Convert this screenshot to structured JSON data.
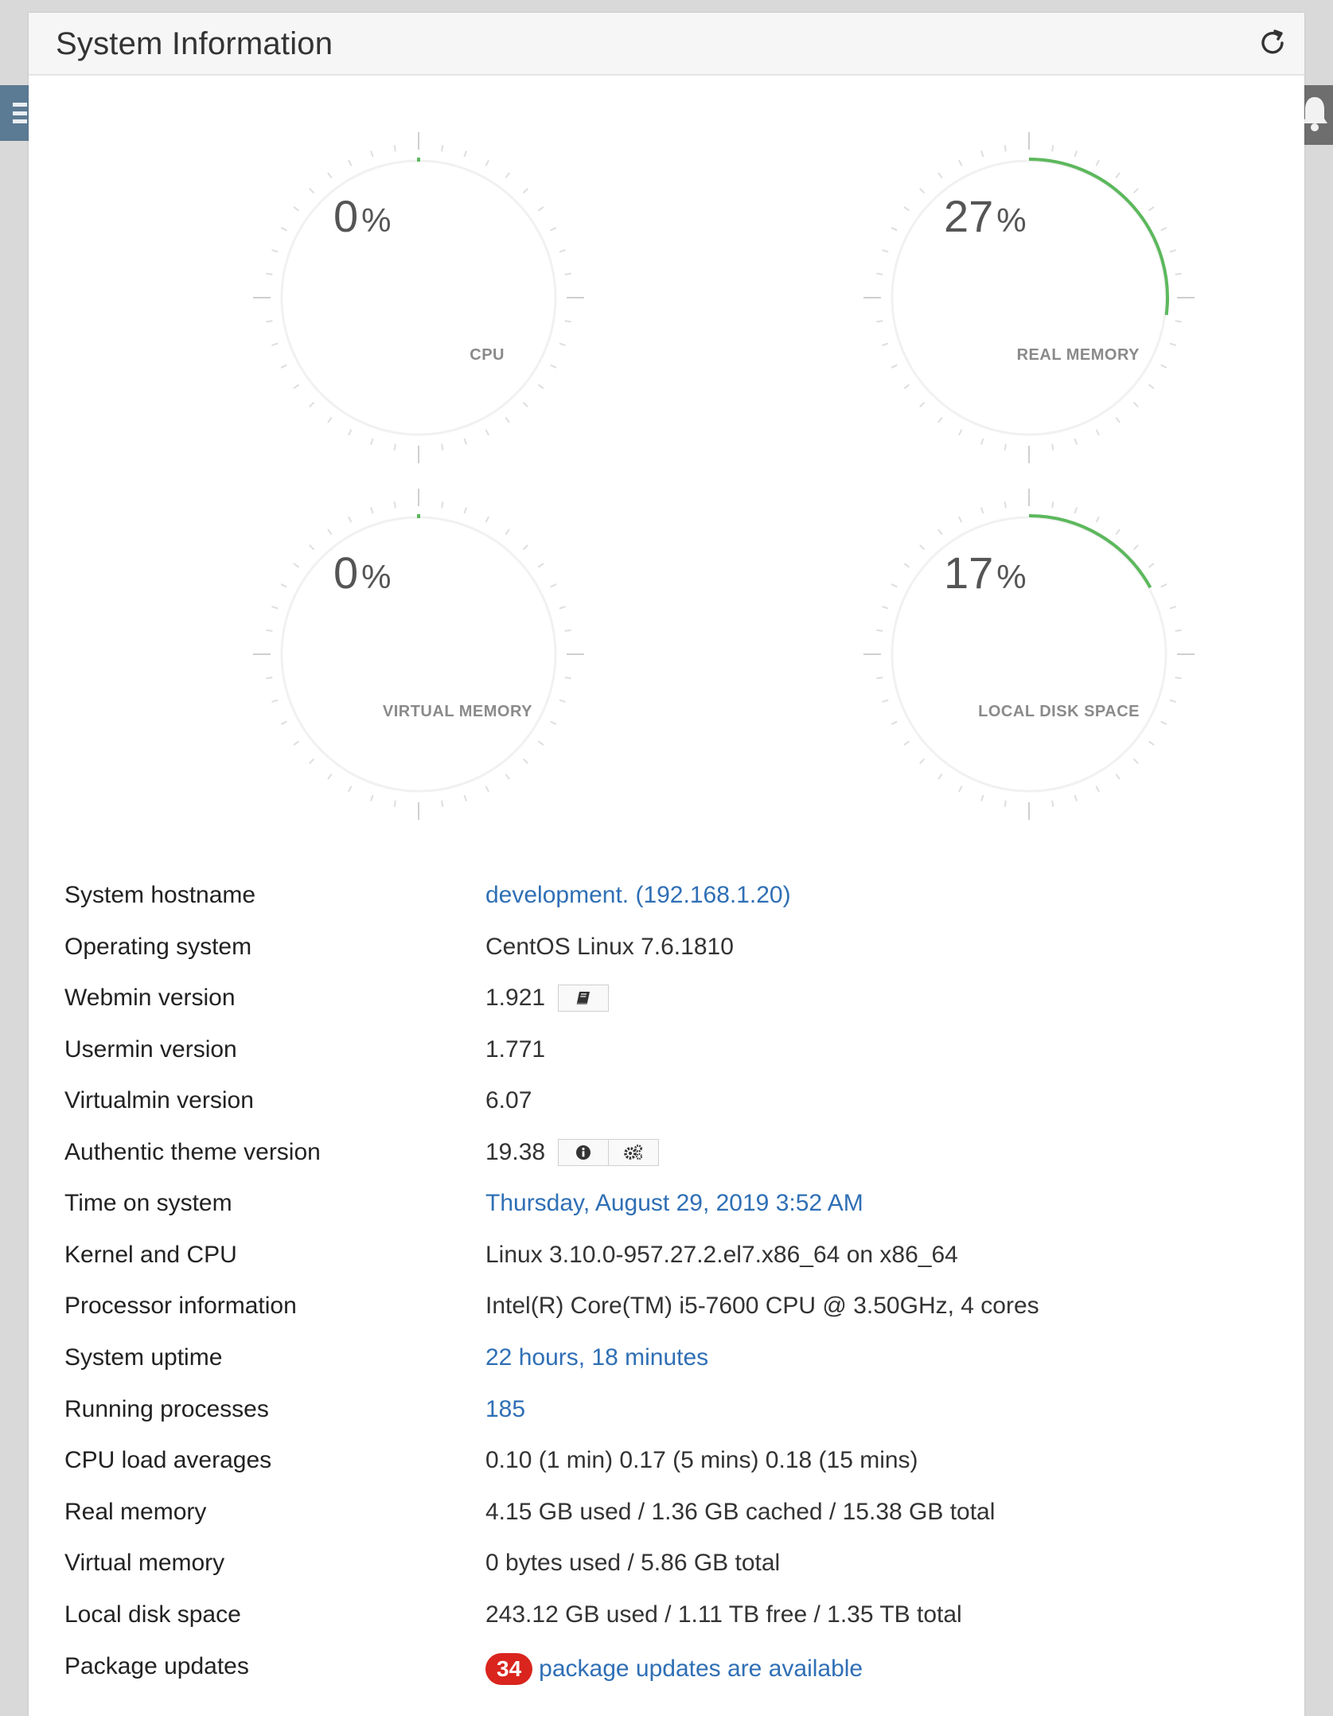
{
  "panel": {
    "title": "System Information"
  },
  "gauges": [
    {
      "value": "0",
      "unit": "%",
      "label": "CPU",
      "percent": 0
    },
    {
      "value": "27",
      "unit": "%",
      "label": "REAL MEMORY",
      "percent": 27
    },
    {
      "value": "0",
      "unit": "%",
      "label": "VIRTUAL MEMORY",
      "percent": 0
    },
    {
      "value": "17",
      "unit": "%",
      "label": "LOCAL DISK SPACE",
      "percent": 17
    }
  ],
  "info": {
    "hostname": {
      "label": "System hostname",
      "value": "development. (192.168.1.20)"
    },
    "os": {
      "label": "Operating system",
      "value": "CentOS Linux 7.6.1810"
    },
    "webmin": {
      "label": "Webmin version",
      "value": "1.921"
    },
    "usermin": {
      "label": "Usermin version",
      "value": "1.771"
    },
    "virtualmin": {
      "label": "Virtualmin version",
      "value": "6.07"
    },
    "theme": {
      "label": "Authentic theme version",
      "value": "19.38"
    },
    "time": {
      "label": "Time on system",
      "value": "Thursday, August 29, 2019 3:52 AM"
    },
    "kernel": {
      "label": "Kernel and CPU",
      "value": "Linux 3.10.0-957.27.2.el7.x86_64 on x86_64"
    },
    "processor": {
      "label": "Processor information",
      "value": "Intel(R) Core(TM) i5-7600 CPU @ 3.50GHz, 4 cores"
    },
    "uptime": {
      "label": "System uptime",
      "value": "22 hours, 18 minutes"
    },
    "processes": {
      "label": "Running processes",
      "value": "185"
    },
    "load": {
      "label": "CPU load averages",
      "value": "0.10 (1 min) 0.17 (5 mins) 0.18 (15 mins)"
    },
    "realmem": {
      "label": "Real memory",
      "value": "4.15 GB used / 1.36 GB cached / 15.38 GB total"
    },
    "virtmem": {
      "label": "Virtual memory",
      "value": "0 bytes used / 5.86 GB total"
    },
    "disk": {
      "label": "Local disk space",
      "value": "243.12 GB used / 1.11 TB free / 1.35 TB total"
    },
    "packages": {
      "label": "Package updates",
      "count": "34",
      "value": "package updates are available"
    }
  },
  "icons": {
    "refresh": "refresh-icon",
    "changelog": "book-icon",
    "theme_info": "info-icon",
    "theme_settings": "cogs-icon",
    "nav": "menu-icon",
    "notifications": "bell-icon"
  },
  "colors": {
    "gauge_arc": "#5cb85c",
    "link": "#2f6fb5",
    "badge": "#d9251d"
  }
}
